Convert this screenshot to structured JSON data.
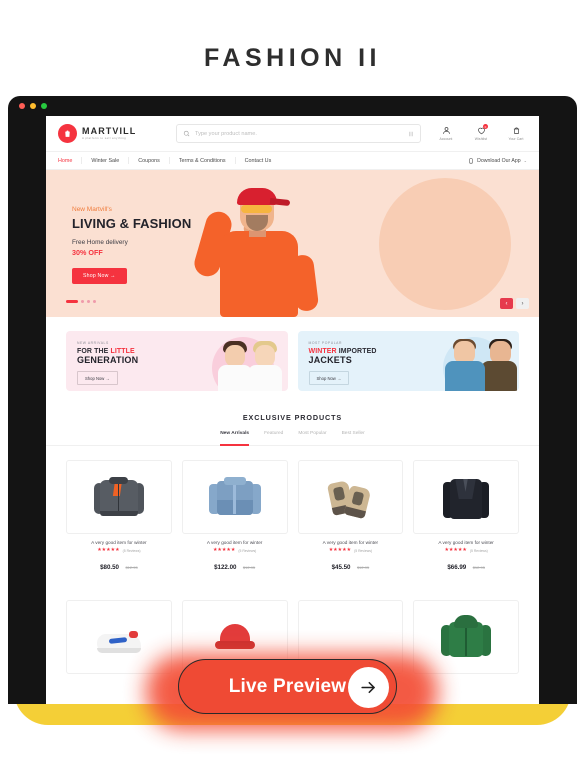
{
  "page": {
    "title": "FASHION II"
  },
  "browser": {
    "dots": [
      "red",
      "yellow",
      "green"
    ]
  },
  "site": {
    "logo": {
      "name": "MARTVILL",
      "tagline": "A platform to sell anything",
      "icon": "shopping-bag-icon"
    },
    "search": {
      "placeholder": "Type your product name.",
      "value": "",
      "icon": "search-icon",
      "filter_icon": "filter-icon"
    },
    "actions": [
      {
        "label": "Account",
        "icon": "user-icon",
        "badge": ""
      },
      {
        "label": "Wishlist",
        "icon": "heart-icon",
        "badge": "0"
      },
      {
        "label": "Your Cart",
        "icon": "bag-icon",
        "badge": ""
      }
    ],
    "nav": {
      "links": [
        {
          "label": "Home",
          "active": true
        },
        {
          "label": "Winter Sale",
          "active": false
        },
        {
          "label": "Coupons",
          "active": false
        },
        {
          "label": "Terms & Conditions",
          "active": false
        },
        {
          "label": "Contact Us",
          "active": false
        }
      ],
      "app": {
        "label": "Download Our App",
        "icon": "mobile-icon",
        "caret": "⌄"
      }
    }
  },
  "hero": {
    "kicker": "New Martvill's",
    "title": "LIVING & FASHION",
    "subtitle": "Free Home delivery",
    "discount": "30% OFF",
    "cta": "Shop Now  →",
    "dots": 4,
    "active_dot": 0,
    "prev": "‹",
    "next": "›"
  },
  "promos": [
    {
      "kicker": "NEW ARRIVALS",
      "line1_prefix": "FOR THE ",
      "line1_accent": "LITTLE",
      "line2": "GENERATION",
      "cta": "Shop Now  →",
      "theme": "pink"
    },
    {
      "kicker": "MOST POPULAR",
      "line1_prefix": "",
      "line1_accent": "WINTER",
      "line1_suffix": " IMPORTED",
      "line2": "JACKETS",
      "cta": "Shop Now  →",
      "theme": "blue"
    }
  ],
  "products_section": {
    "title": "EXCLUSIVE PRODUCTS",
    "tabs": [
      {
        "label": "New Arrivals",
        "active": true
      },
      {
        "label": "Featured",
        "active": false
      },
      {
        "label": "Most Popular",
        "active": false
      },
      {
        "label": "Best Seller",
        "active": false
      }
    ],
    "row1": [
      {
        "name": "A very good item for winter",
        "stars": "★★★★★",
        "reviews": "(5 Reviews)",
        "price": "$80.50",
        "old_price": "$12.95",
        "art": "bomber-jacket"
      },
      {
        "name": "A very good item for winter",
        "stars": "★★★★★",
        "reviews": "(5 Reviews)",
        "price": "$122.00",
        "old_price": "$12.95",
        "art": "denim-jacket"
      },
      {
        "name": "A very good item for winter",
        "stars": "★★★★★",
        "reviews": "(5 Reviews)",
        "price": "$45.50",
        "old_price": "$12.95",
        "art": "hiking-boots"
      },
      {
        "name": "A very good item for winter",
        "stars": "★★★★★",
        "reviews": "(5 Reviews)",
        "price": "$66.99",
        "old_price": "$12.95",
        "art": "black-blazer"
      }
    ],
    "row2": [
      {
        "art": "white-sneaker"
      },
      {
        "art": "red-cap"
      },
      {
        "art": "blank"
      },
      {
        "art": "green-jacket"
      }
    ]
  },
  "cta": {
    "label": "Live Preview",
    "arrow_icon": "arrow-right-icon"
  },
  "colors": {
    "brand_red": "#f5333f",
    "cta_coral": "#ef4a34",
    "yellow": "#f2d03c",
    "hero_bg": "#fbe0d2",
    "promo_pink": "#fce9ef",
    "promo_blue": "#e4f2fa",
    "frame_dark": "#141414"
  }
}
